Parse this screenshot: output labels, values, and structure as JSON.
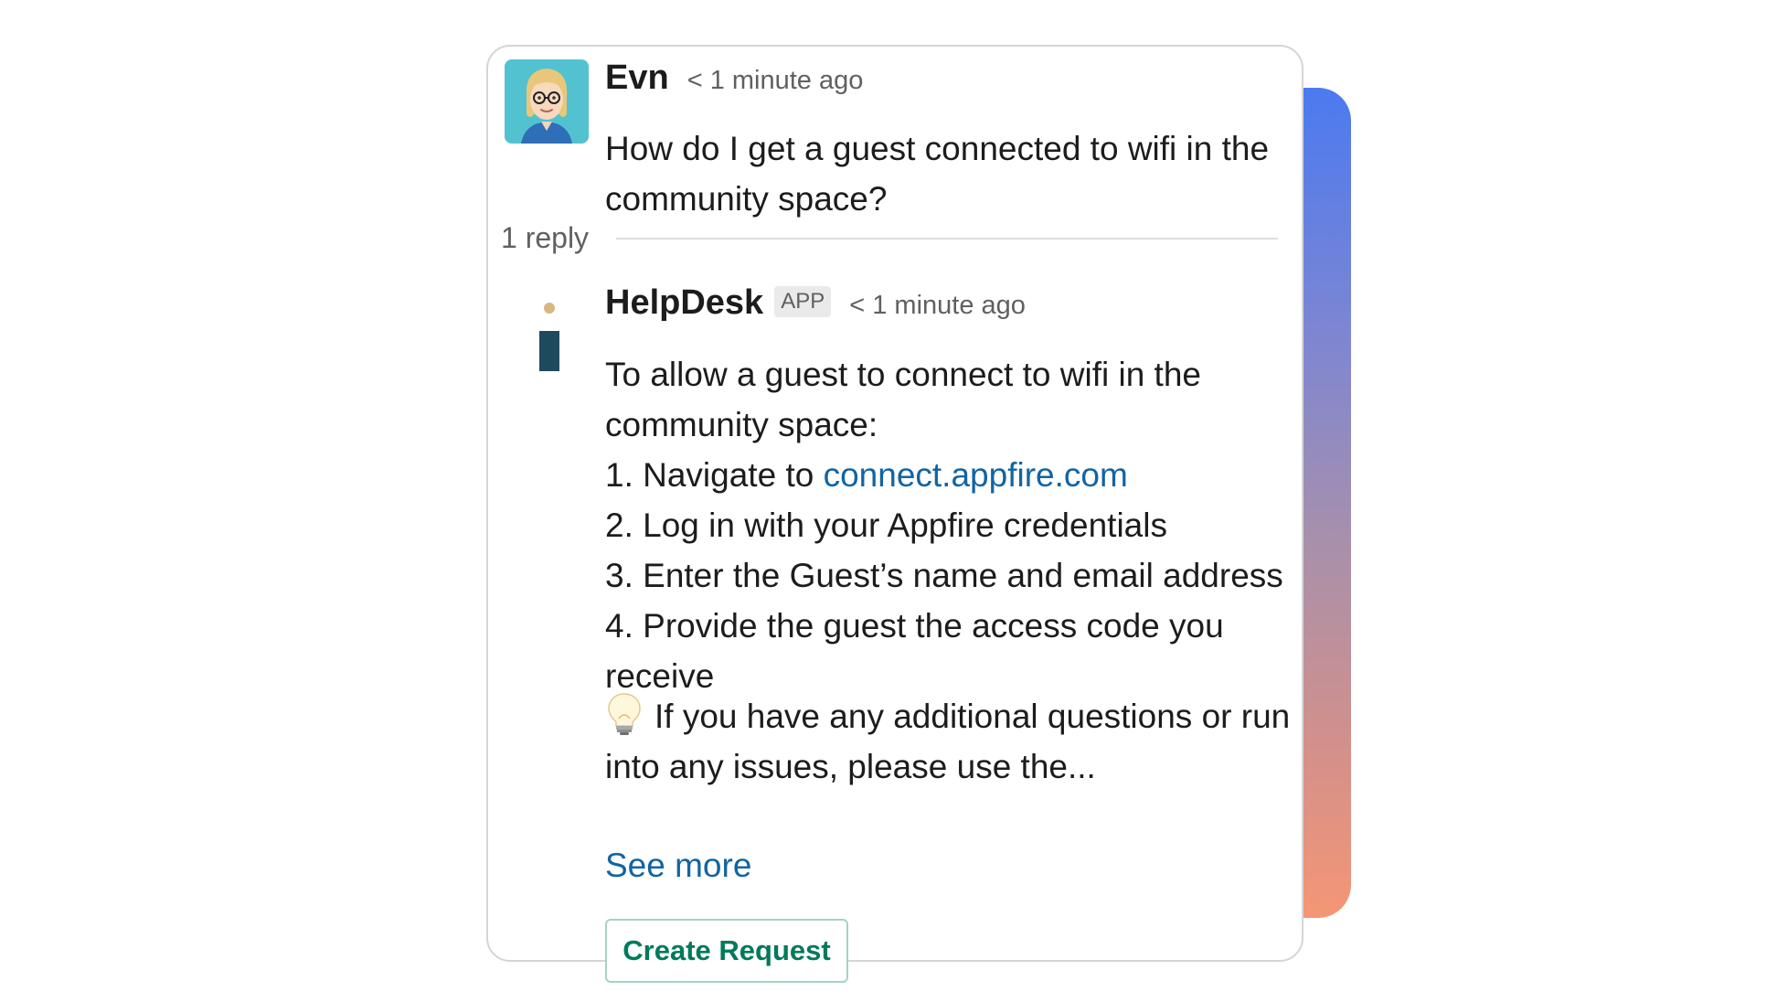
{
  "message": {
    "sender": "Evn",
    "timestamp": "< 1 minute ago",
    "text": "How do I get a guest connected to wifi in the community space?",
    "avatar_icon": "bitmoji-avatar"
  },
  "thread": {
    "reply_count": "1 reply"
  },
  "reply": {
    "sender": "HelpDesk",
    "badge": "APP",
    "timestamp": "< 1 minute ago",
    "logo_icon": "helpdesk-i-logo",
    "intro": "To allow a guest to connect to wifi in the community space:",
    "steps": [
      {
        "prefix": "1. Navigate to ",
        "link": "connect.appfire.com"
      },
      {
        "text": "2. Log in with your Appfire credentials"
      },
      {
        "text": "3. Enter the Guest’s name and email address"
      },
      {
        "text": "4. Provide the guest the access code you receive"
      }
    ],
    "tip_icon": "lightbulb-icon",
    "tip": "If you have any additional questions or run into any issues, please use the...",
    "see_more": "See more",
    "button_label": "Create Request"
  },
  "colors": {
    "link": "#1264a3",
    "button_text": "#007a5a",
    "gradient_top": "#4b7af0",
    "gradient_bottom": "#f59675"
  }
}
